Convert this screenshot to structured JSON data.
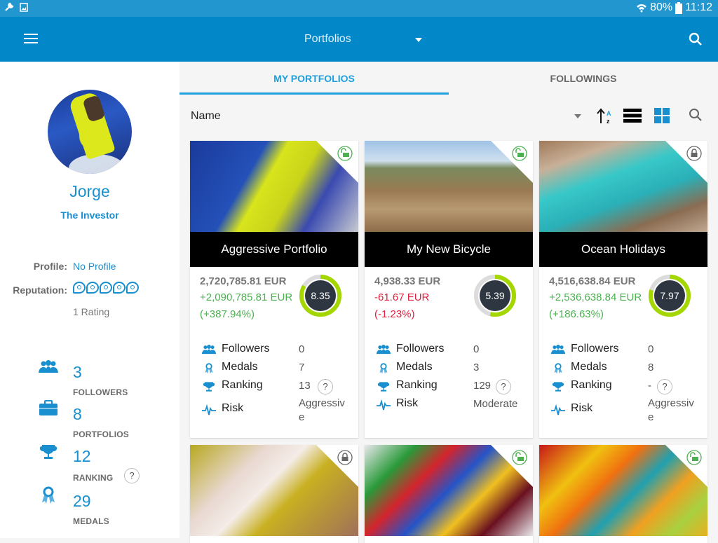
{
  "status_bar": {
    "battery": "80%",
    "time": "11:12"
  },
  "app_bar": {
    "title": "Portfolios"
  },
  "profile": {
    "name": "Jorge",
    "subtitle": "The Investor",
    "profile_label": "Profile:",
    "profile_value": "No Profile",
    "reputation_label": "Reputation:",
    "reputation_score": 5,
    "rating_count": "1 Rating",
    "stats": [
      {
        "value": "3",
        "label": "FOLLOWERS"
      },
      {
        "value": "8",
        "label": "PORTFOLIOS"
      },
      {
        "value": "12",
        "label": "RANKING"
      },
      {
        "value": "29",
        "label": "MEDALS"
      }
    ],
    "help": "?"
  },
  "tabs": [
    {
      "label": "MY PORTFOLIOS",
      "active": true
    },
    {
      "label": "FOLLOWINGS",
      "active": false
    }
  ],
  "toolbar": {
    "sort_by": "Name",
    "sort_icon_letters": [
      "A",
      "z"
    ]
  },
  "colors": {
    "accent": "#1e9fdc",
    "app_bar": "#0288c9",
    "positive": "#4caf50",
    "negative": "#e0213f",
    "ring_fill": "#a4d600",
    "ring_center": "#2e3642",
    "lock_public": "#4caf50",
    "lock_private": "#666666"
  },
  "metric_labels": {
    "followers": "Followers",
    "medals": "Medals",
    "ranking": "Ranking",
    "risk": "Risk"
  },
  "portfolios": [
    {
      "name": "Aggressive Portfolio",
      "locked": false,
      "value": "2,720,785.81 EUR",
      "change": "+2,090,785.81 EUR",
      "change_pct": "(+387.94%)",
      "positive": true,
      "score": "8.35",
      "score_fraction": 0.835,
      "followers": "0",
      "medals": "7",
      "ranking": "13",
      "risk": "Aggressive"
    },
    {
      "name": "My New Bicycle",
      "locked": false,
      "value": "4,938.33 EUR",
      "change": "-61.67 EUR",
      "change_pct": "(-1.23%)",
      "positive": false,
      "score": "5.39",
      "score_fraction": 0.539,
      "followers": "0",
      "medals": "3",
      "ranking": "129",
      "risk": "Moderate"
    },
    {
      "name": "Ocean Holidays",
      "locked": true,
      "value": "4,516,638.84 EUR",
      "change": "+2,536,638.84 EUR",
      "change_pct": "(+186.63%)",
      "positive": true,
      "score": "7.97",
      "score_fraction": 0.797,
      "followers": "0",
      "medals": "8",
      "ranking": "-",
      "risk": "Aggressive"
    },
    {
      "name": "",
      "locked": true
    },
    {
      "name": "",
      "locked": false
    },
    {
      "name": "",
      "locked": false
    }
  ]
}
